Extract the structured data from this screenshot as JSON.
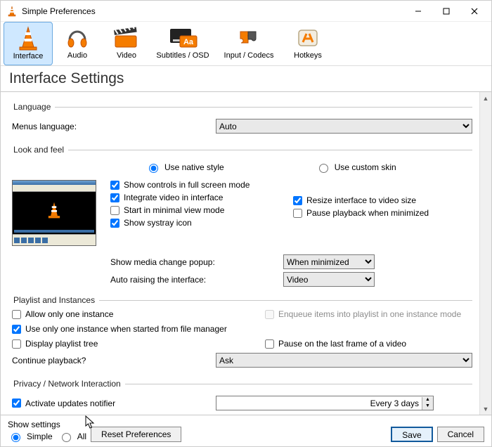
{
  "titlebar": {
    "title": "Simple Preferences"
  },
  "tabs": {
    "interface": "Interface",
    "audio": "Audio",
    "video": "Video",
    "subs": "Subtitles / OSD",
    "input": "Input / Codecs",
    "hotkeys": "Hotkeys"
  },
  "page_title": "Interface Settings",
  "language": {
    "legend": "Language",
    "menus_label": "Menus language:",
    "selected": "Auto"
  },
  "look": {
    "legend": "Look and feel",
    "opt_native": "Use native style",
    "opt_custom": "Use custom skin",
    "ck_fullscreen": "Show controls in full screen mode",
    "ck_integrate": "Integrate video in interface",
    "ck_minimal": "Start in minimal view mode",
    "ck_systray": "Show systray icon",
    "ck_resize": "Resize interface to video size",
    "ck_pause_min": "Pause playback when minimized",
    "popup_label": "Show media change popup:",
    "popup_selected": "When minimized",
    "raise_label": "Auto raising the interface:",
    "raise_selected": "Video"
  },
  "playlist": {
    "legend": "Playlist and Instances",
    "ck_one": "Allow only one instance",
    "ck_filemgr": "Use only one instance when started from file manager",
    "ck_tree": "Display playlist tree",
    "ck_enqueue": "Enqueue items into playlist in one instance mode",
    "ck_lastframe": "Pause on the last frame of a video",
    "continue_label": "Continue playback?",
    "continue_selected": "Ask"
  },
  "privacy": {
    "legend": "Privacy / Network Interaction",
    "ck_updates": "Activate updates notifier",
    "updates_value": "Every 3 days"
  },
  "bottom": {
    "show_label": "Show settings",
    "opt_simple": "Simple",
    "opt_all": "All",
    "reset": "Reset Preferences",
    "save": "Save",
    "cancel": "Cancel"
  }
}
